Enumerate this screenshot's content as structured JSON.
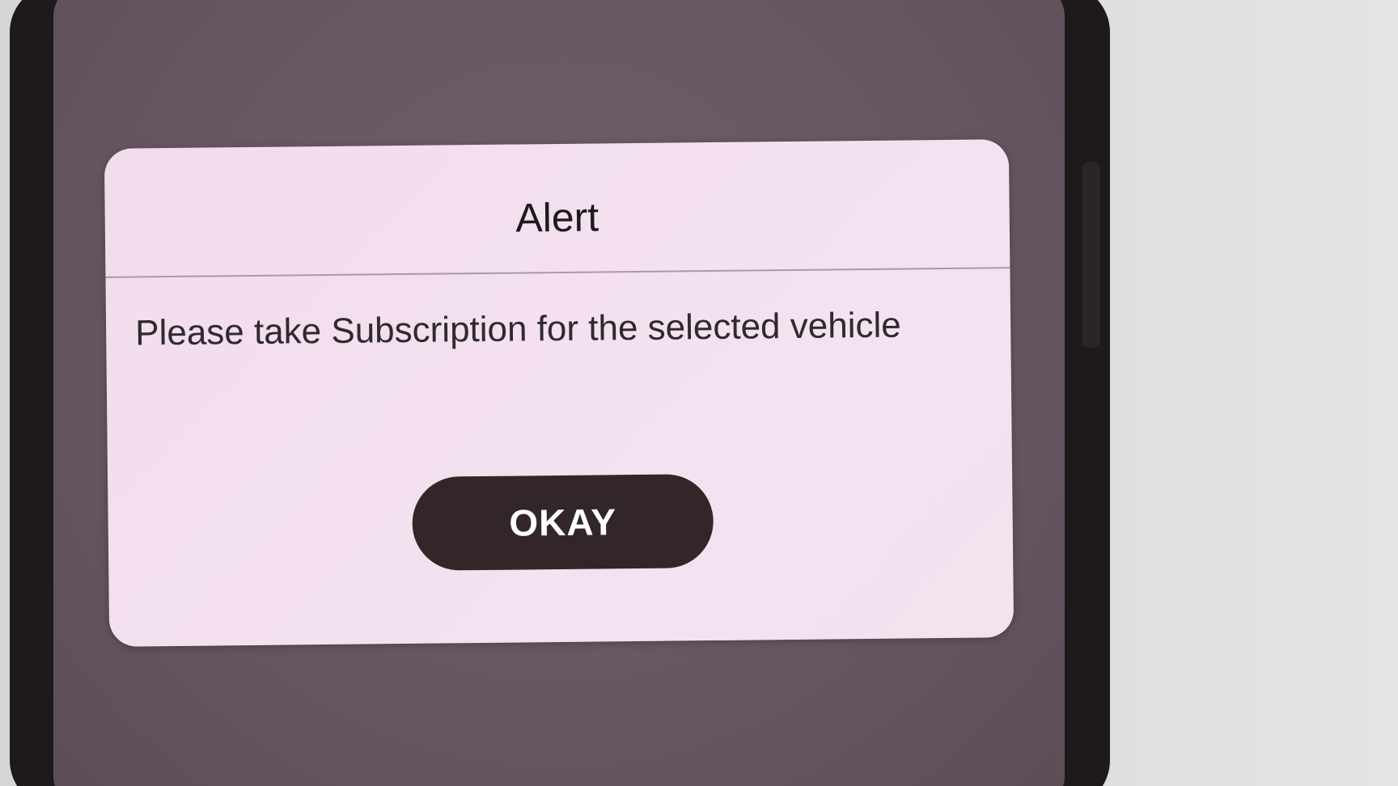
{
  "dialog": {
    "title": "Alert",
    "message": "Please take Subscription for the selected vehicle",
    "ok_label": "OKAY"
  },
  "colors": {
    "dialog_background": "#f3e0ef",
    "button_background": "#332629",
    "button_text": "#ffffff",
    "screen_overlay": "#675762"
  }
}
